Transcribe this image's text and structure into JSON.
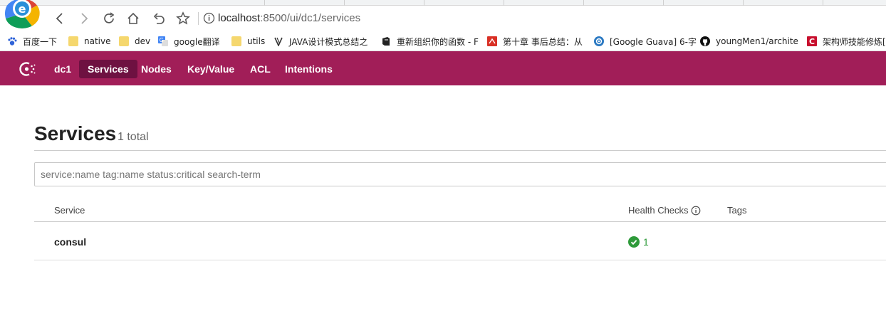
{
  "browser": {
    "url_host": "localhost",
    "url_path": ":8500/ui/dc1/services",
    "bookmarks": [
      {
        "label": "百度一下",
        "icon": "paw-icon"
      },
      {
        "label": "native",
        "icon": "folder-icon"
      },
      {
        "label": "dev",
        "icon": "folder-icon"
      },
      {
        "label": "google翻译",
        "icon": "translate-icon"
      },
      {
        "label": "utils",
        "icon": "folder-icon"
      },
      {
        "label": "JAVA设计模式总结之",
        "icon": "java-icon"
      },
      {
        "label": "重新组织你的函数 - F",
        "icon": "book-icon"
      },
      {
        "label": "第十章 事后总结：从",
        "icon": "site-icon"
      },
      {
        "label": "[Google Guava] 6-字",
        "icon": "settings-icon"
      },
      {
        "label": "youngMen1/archite",
        "icon": "github-icon"
      },
      {
        "label": "架构师技能修炼[",
        "icon": "site-c-icon"
      }
    ]
  },
  "header": {
    "datacenter": "dc1",
    "nav": [
      "Services",
      "Nodes",
      "Key/Value",
      "ACL",
      "Intentions"
    ],
    "active_nav": "Services",
    "brand_color": "#a11e58",
    "active_color": "#6e1141"
  },
  "main": {
    "title": "Services",
    "total": "1 total",
    "search_placeholder": "service:name tag:name status:critical search-term",
    "columns": {
      "service": "Service",
      "health": "Health Checks",
      "tags": "Tags"
    },
    "rows": [
      {
        "service": "consul",
        "health_passing": "1",
        "tags": ""
      }
    ],
    "passing_color": "#2e9a3a"
  }
}
